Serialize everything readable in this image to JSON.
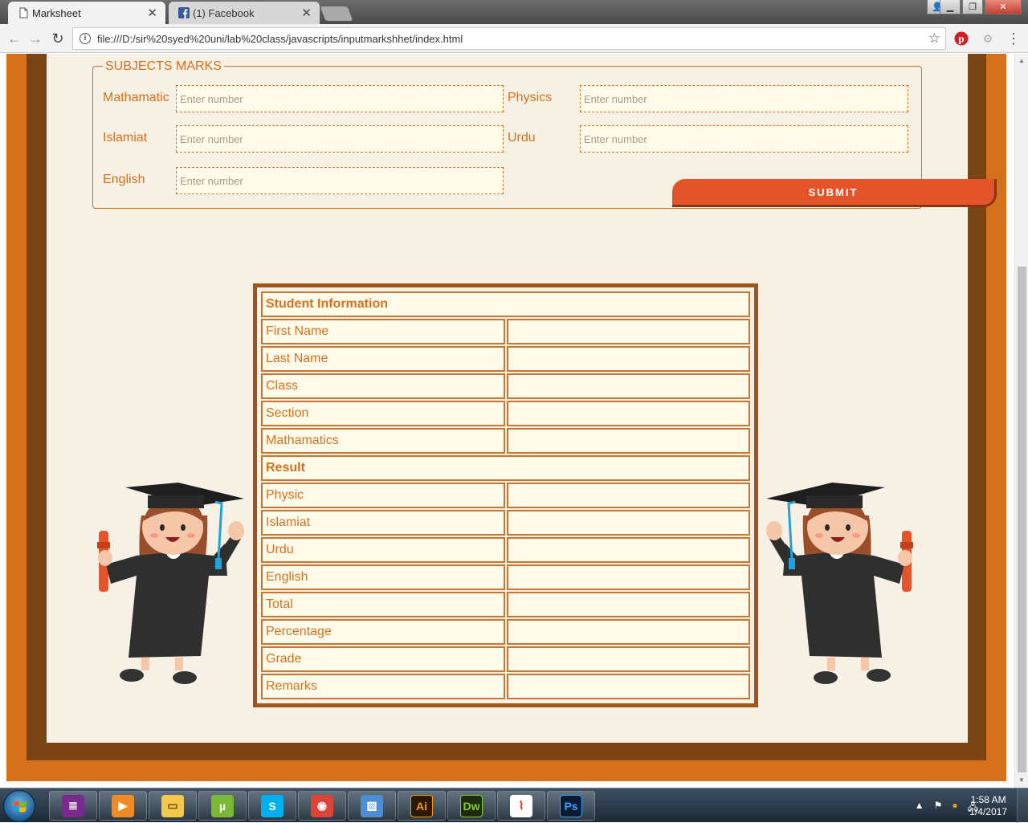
{
  "browser": {
    "tabs": [
      {
        "title": "Marksheet",
        "icon": "page-icon",
        "active": true
      },
      {
        "title": "(1) Facebook",
        "icon": "facebook-icon",
        "active": false
      }
    ],
    "url": "file:///D:/sir%20syed%20uni/lab%20class/javascripts/inputmarkshhet/index.html"
  },
  "form": {
    "legend": "SUBJECTS MARKS",
    "fields": {
      "math": {
        "label": "Mathamatic",
        "placeholder": "Enter number"
      },
      "physics": {
        "label": "Physics",
        "placeholder": "Enter number"
      },
      "islamiat": {
        "label": "Islamiat",
        "placeholder": "Enter number"
      },
      "urdu": {
        "label": "Urdu",
        "placeholder": "Enter number"
      },
      "english": {
        "label": "English",
        "placeholder": "Enter number"
      }
    },
    "submit_label": "SUBMIT"
  },
  "table": {
    "info_header": "Student Information",
    "info_rows": [
      "First Name",
      "Last Name",
      "Class",
      "Section",
      "Mathamatics"
    ],
    "result_header": "Result",
    "result_rows": [
      "Physic",
      "Islamiat",
      "Urdu",
      "English",
      "Total",
      "Percentage",
      "Grade",
      "Remarks"
    ]
  },
  "taskbar": {
    "items": [
      "winrar-icon",
      "media-player-icon",
      "file-explorer-icon",
      "utorrent-icon",
      "skype-icon",
      "chrome-icon",
      "image-viewer-icon",
      "illustrator-icon",
      "dreamweaver-icon",
      "acrobat-icon",
      "photoshop-icon"
    ],
    "illustrator_label": "Ai",
    "dreamweaver_label": "Dw",
    "photoshop_label": "Ps",
    "time": "1:58 AM",
    "date": "1/4/2017"
  },
  "colors": {
    "accent": "#d5701d",
    "frame_dark": "#7a4414",
    "paper": "#f6f0e5",
    "submit": "#e4542a"
  }
}
